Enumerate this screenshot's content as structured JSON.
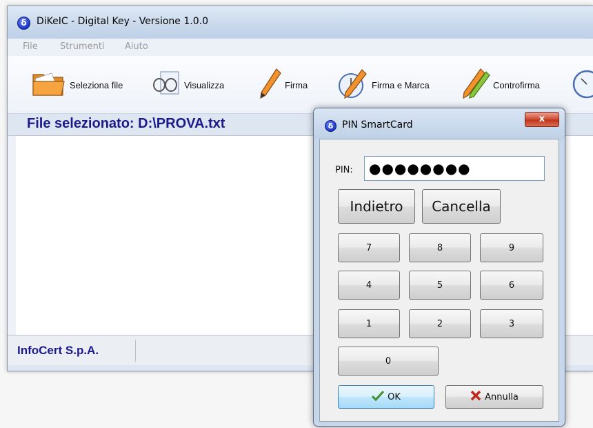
{
  "window": {
    "title": "DiKeIC - Digital Key - Versione 1.0.0",
    "app_icon_glyph": "δ"
  },
  "menu": {
    "items": [
      "File",
      "Strumenti",
      "Aiuto"
    ]
  },
  "toolbar": {
    "buttons": [
      {
        "label": "Seleziona file",
        "icon": "folder-icon"
      },
      {
        "label": "Visualizza",
        "icon": "glasses-icon"
      },
      {
        "label": "Firma",
        "icon": "pen-icon"
      },
      {
        "label": "Firma e Marca",
        "icon": "pen-clock-icon"
      },
      {
        "label": "Controfirma",
        "icon": "double-pen-icon"
      }
    ]
  },
  "file_bar": {
    "text": "File selezionato: D:\\PROVA.txt"
  },
  "status_bar": {
    "company": "InfoCert S.p.A."
  },
  "dialog": {
    "title": "PIN SmartCard",
    "close_glyph": "x",
    "pin_label": "PIN:",
    "pin_value": "●●●●●●●●",
    "back_label": "Indietro",
    "clear_label": "Cancella",
    "keys": [
      "7",
      "8",
      "9",
      "4",
      "5",
      "6",
      "1",
      "2",
      "3",
      "0"
    ],
    "ok_label": "OK",
    "cancel_label": "Annulla"
  },
  "colors": {
    "title_text": "#000000",
    "file_bar_text": "#1a1a8a",
    "status_text": "#1a1a8a",
    "close_button": "#c7412a",
    "ok_check": "#3e8e2f",
    "cancel_x": "#c0281b"
  }
}
